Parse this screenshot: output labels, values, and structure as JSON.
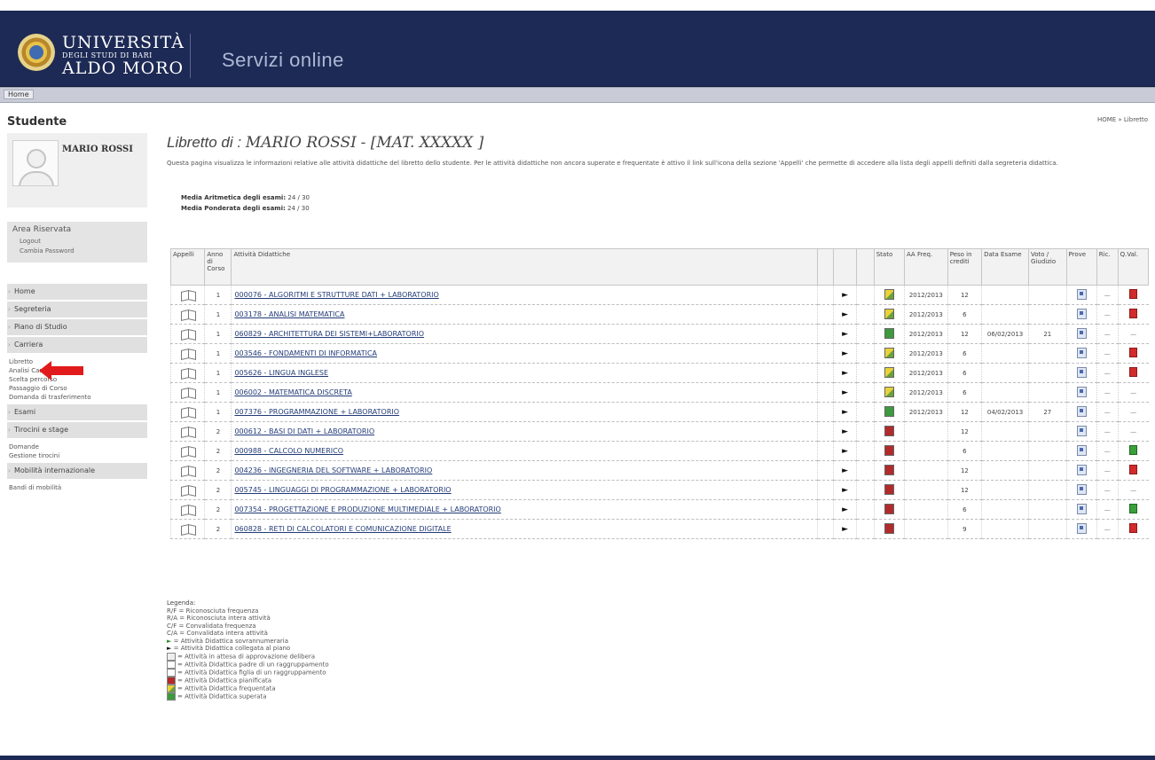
{
  "header": {
    "university_line1": "UNIVERSITÀ",
    "university_line2": "DEGLI STUDI DI BARI",
    "university_line3": "ALDO MORO",
    "service_title": "Servizi online",
    "nav_home": "Home"
  },
  "sidebar": {
    "section_title": "Studente",
    "profile_name": "MARIO ROSSI",
    "area": {
      "title": "Area Riservata",
      "links": [
        "Logout",
        "Cambia Password"
      ]
    },
    "menu": [
      {
        "label": "Home",
        "items": []
      },
      {
        "label": "Segreteria",
        "items": []
      },
      {
        "label": "Piano di Studio",
        "items": []
      },
      {
        "label": "Carriera",
        "items": [
          "Libretto",
          "Analisi Carriera",
          "Scelta percorso",
          "Passaggio di Corso",
          "Domanda di trasferimento"
        ]
      },
      {
        "label": "Esami",
        "items": []
      },
      {
        "label": "Tirocini e stage",
        "items": [
          "Domande",
          "Gestione tirocini"
        ]
      },
      {
        "label": "Mobilità internazionale",
        "items": [
          "Bandi di mobilità"
        ]
      }
    ]
  },
  "main": {
    "breadcrumb": "HOME » Libretto",
    "title_prefix": "Libretto di :",
    "title_name": "MARIO ROSSI",
    "title_suffix": " - [MAT. XXXXX ]",
    "intro": "Questa pagina visualizza le informazioni relative alle attività didattiche del libretto dello studente. Per le attività didattiche non ancora superate e frequentate è attivo il link sull'icona della sezione 'Appelli' che permette di accedere alla lista degli appelli definiti dalla segreteria didattica.",
    "media_aritmetica_label": "Media Aritmetica degli esami:",
    "media_aritmetica_value": "24 / 30",
    "media_ponderata_label": "Media Ponderata degli esami:",
    "media_ponderata_value": "24 / 30",
    "columns": {
      "appelli": "Appelli",
      "anno": "Anno di Corso",
      "attivita": "Attività Didattiche",
      "stato": "Stato",
      "aa_freq": "AA Freq.",
      "peso": "Peso in crediti",
      "data": "Data Esame",
      "voto": "Voto / Giudizio",
      "prove": "Prove",
      "ric": "Ric.",
      "qval": "Q.Val."
    },
    "rows": [
      {
        "anno": "1",
        "name": "000076 - ALGORITMI E STRUTTURE DATI + LABORATORIO",
        "stato": "y",
        "aa": "2012/2013",
        "peso": "12",
        "data": "",
        "voto": "",
        "ric": "—",
        "qval": "r"
      },
      {
        "anno": "1",
        "name": "003178 - ANALISI MATEMATICA",
        "stato": "y",
        "aa": "2012/2013",
        "peso": "6",
        "data": "",
        "voto": "",
        "ric": "—",
        "qval": "r"
      },
      {
        "anno": "1",
        "name": "060829 - ARCHITETTURA DEI SISTEMI+LABORATORIO",
        "stato": "g",
        "aa": "2012/2013",
        "peso": "12",
        "data": "06/02/2013",
        "voto": "21",
        "ric": "—",
        "qval": "-"
      },
      {
        "anno": "1",
        "name": "003546 - FONDAMENTI DI INFORMATICA",
        "stato": "y",
        "aa": "2012/2013",
        "peso": "6",
        "data": "",
        "voto": "",
        "ric": "—",
        "qval": "r"
      },
      {
        "anno": "1",
        "name": "005626 - LINGUA INGLESE",
        "stato": "y",
        "aa": "2012/2013",
        "peso": "6",
        "data": "",
        "voto": "",
        "ric": "—",
        "qval": "r"
      },
      {
        "anno": "1",
        "name": "006002 - MATEMATICA DISCRETA",
        "stato": "y",
        "aa": "2012/2013",
        "peso": "6",
        "data": "",
        "voto": "",
        "ric": "—",
        "qval": "-"
      },
      {
        "anno": "1",
        "name": "007376 - PROGRAMMAZIONE + LABORATORIO",
        "stato": "g",
        "aa": "2012/2013",
        "peso": "12",
        "data": "04/02/2013",
        "voto": "27",
        "ric": "—",
        "qval": "-"
      },
      {
        "anno": "2",
        "name": "000612 - BASI DI DATI + LABORATORIO",
        "stato": "r",
        "aa": "",
        "peso": "12",
        "data": "",
        "voto": "",
        "ric": "—",
        "qval": "-"
      },
      {
        "anno": "2",
        "name": "000988 - CALCOLO NUMERICO",
        "stato": "r",
        "aa": "",
        "peso": "6",
        "data": "",
        "voto": "",
        "ric": "—",
        "qval": "g"
      },
      {
        "anno": "2",
        "name": "004236 - INGEGNERIA DEL SOFTWARE + LABORATORIO",
        "stato": "r",
        "aa": "",
        "peso": "12",
        "data": "",
        "voto": "",
        "ric": "—",
        "qval": "r"
      },
      {
        "anno": "2",
        "name": "005745 - LINGUAGGI DI PROGRAMMAZIONE + LABORATORIO",
        "stato": "r",
        "aa": "",
        "peso": "12",
        "data": "",
        "voto": "",
        "ric": "—",
        "qval": "-"
      },
      {
        "anno": "2",
        "name": "007354 - PROGETTAZIONE E PRODUZIONE MULTIMEDIALE + LABORATORIO",
        "stato": "r",
        "aa": "",
        "peso": "6",
        "data": "",
        "voto": "",
        "ric": "—",
        "qval": "g"
      },
      {
        "anno": "2",
        "name": "060828 - RETI DI CALCOLATORI E COMUNICAZIONE DIGITALE",
        "stato": "r",
        "aa": "",
        "peso": "9",
        "data": "",
        "voto": "",
        "ric": "—",
        "qval": "r"
      }
    ],
    "legenda": {
      "title": "Legenda:",
      "items": [
        "R/F = Riconosciuta frequenza",
        "R/A = Riconosciuta intera attività",
        "C/F = Convalidata frequenza",
        "C/A = Convalidata intera attività",
        "= Attività Didattica sovrannumeraria",
        "= Attività Didattica collegata al piano",
        "= Attività in attesa di approvazione delibera",
        "= Attività Didattica padre di un raggruppamento",
        "= Attività Didattica figlia di un raggruppamento",
        "= Attività Didattica pianificata",
        "= Attività Didattica frequentata",
        "= Attività Didattica superata"
      ]
    }
  },
  "colors": {
    "header_bg": "#1d2a55",
    "link": "#223b78",
    "state_planned": "#b22a2a",
    "state_passed": "#3e9a3e",
    "state_attended": "#e8d23a"
  }
}
